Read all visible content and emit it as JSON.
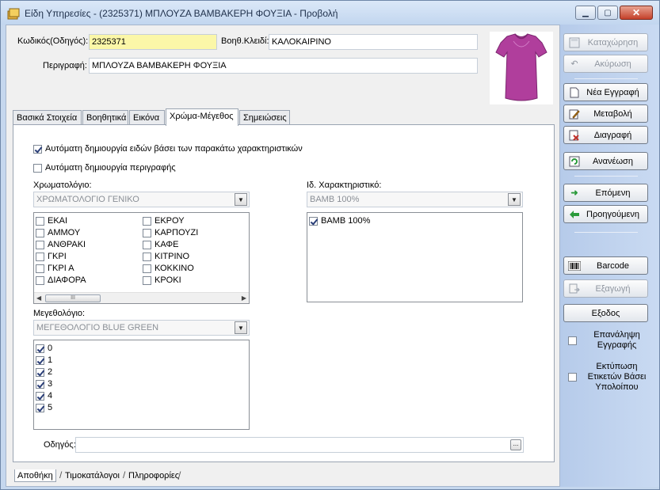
{
  "window": {
    "title": "Είδη Υπηρεσίες - (2325371) ΜΠΛΟΥΖΑ ΒΑΜΒΑΚΕΡΗ ΦΟΥΞΙΑ -  Προβολή",
    "minimize": "▁",
    "maximize": "▢",
    "close": "✕"
  },
  "header": {
    "code_label": "Κωδικός(Οδηγός):",
    "code_value": "2325371",
    "aux_key_label": "Βοηθ.Κλειδί:",
    "aux_key_value": "ΚΑΛΟΚΑΙΡΙΝΟ",
    "description_label": "Περιγραφή:",
    "description_value": "ΜΠΛΟΥΖΑ ΒΑΜΒΑΚΕΡΗ ΦΟΥΞΙΑ"
  },
  "tabs": [
    {
      "label": "Βασικά Στοιχεία"
    },
    {
      "label": "Βοηθητικά"
    },
    {
      "label": "Εικόνα"
    },
    {
      "label": "Χρώμα-Μέγεθος"
    },
    {
      "label": "Σημειώσεις"
    }
  ],
  "panel": {
    "auto_create_items_label": "Αυτόματη δημιουργία ειδών βάσει των παρακάτω χαρακτηριστικών",
    "auto_create_items_checked": true,
    "auto_create_desc_label": "Αυτόματη δημιουργία περιγραφής",
    "auto_create_desc_checked": false,
    "color_catalog_label": "Χρωματολόγιο:",
    "color_catalog_value": "ΧΡΩΜΑΤΟΛΟΓΙΟ ΓΕΝΙΚΟ",
    "colors_col1": [
      "ΕΚΑΙ",
      "ΑΜΜΟΥ",
      "ΑΝΘΡΑΚΙ",
      "ΓΚΡΙ",
      "ΓΚΡΙ Α",
      "ΔΙΑΦΟΡΑ"
    ],
    "colors_col2": [
      "ΕΚΡΟΥ",
      "ΚΑΡΠΟΥΖΙ",
      "ΚΑΦΕ",
      "ΚΙΤΡΙΝΟ",
      "ΚΟΚΚΙΝΟ",
      "ΚΡΟΚΙ"
    ],
    "scroll_thumb": "III",
    "size_catalog_label": "Μεγεθολόγιο:",
    "size_catalog_value": "ΜΕΓΕΘΟΛΟΓΙΟ BLUE GREEN",
    "sizes": [
      "0",
      "1",
      "2",
      "3",
      "4",
      "5"
    ],
    "special_char_label": "Ιδ. Χαρακτηριστικό:",
    "special_char_value": "ΒΑΜΒ 100%",
    "special_char_items": [
      "ΒΑΜΒ 100%"
    ],
    "guide_label": "Οδηγός:",
    "guide_value": "",
    "ellipsis": "..."
  },
  "bottom_tabs": [
    {
      "label": "Αποθήκη"
    },
    {
      "label": "Τιμοκατάλογοι"
    },
    {
      "label": "Πληροφορίες"
    }
  ],
  "sidebar": {
    "save": "Καταχώρηση",
    "cancel": "Ακύρωση",
    "new_record": "Νέα Εγγραφή",
    "edit": "Μεταβολή",
    "delete": "Διαγραφή",
    "refresh": "Ανανέωση",
    "next": "Επόμενη",
    "previous": "Προηγούμενη",
    "barcode": "Barcode",
    "export": "Εξαγωγή",
    "exit": "Εξοδος",
    "repeat_record": "Επανάληψη Εγγραφής",
    "print_labels": "Εκτύπωση Ετικετών Βάσει Υπολοίπου"
  },
  "colors": {
    "yellow_field": "#fbf7a8",
    "sidebar": "#c5d7ee",
    "shirt": "#b03e9c"
  }
}
